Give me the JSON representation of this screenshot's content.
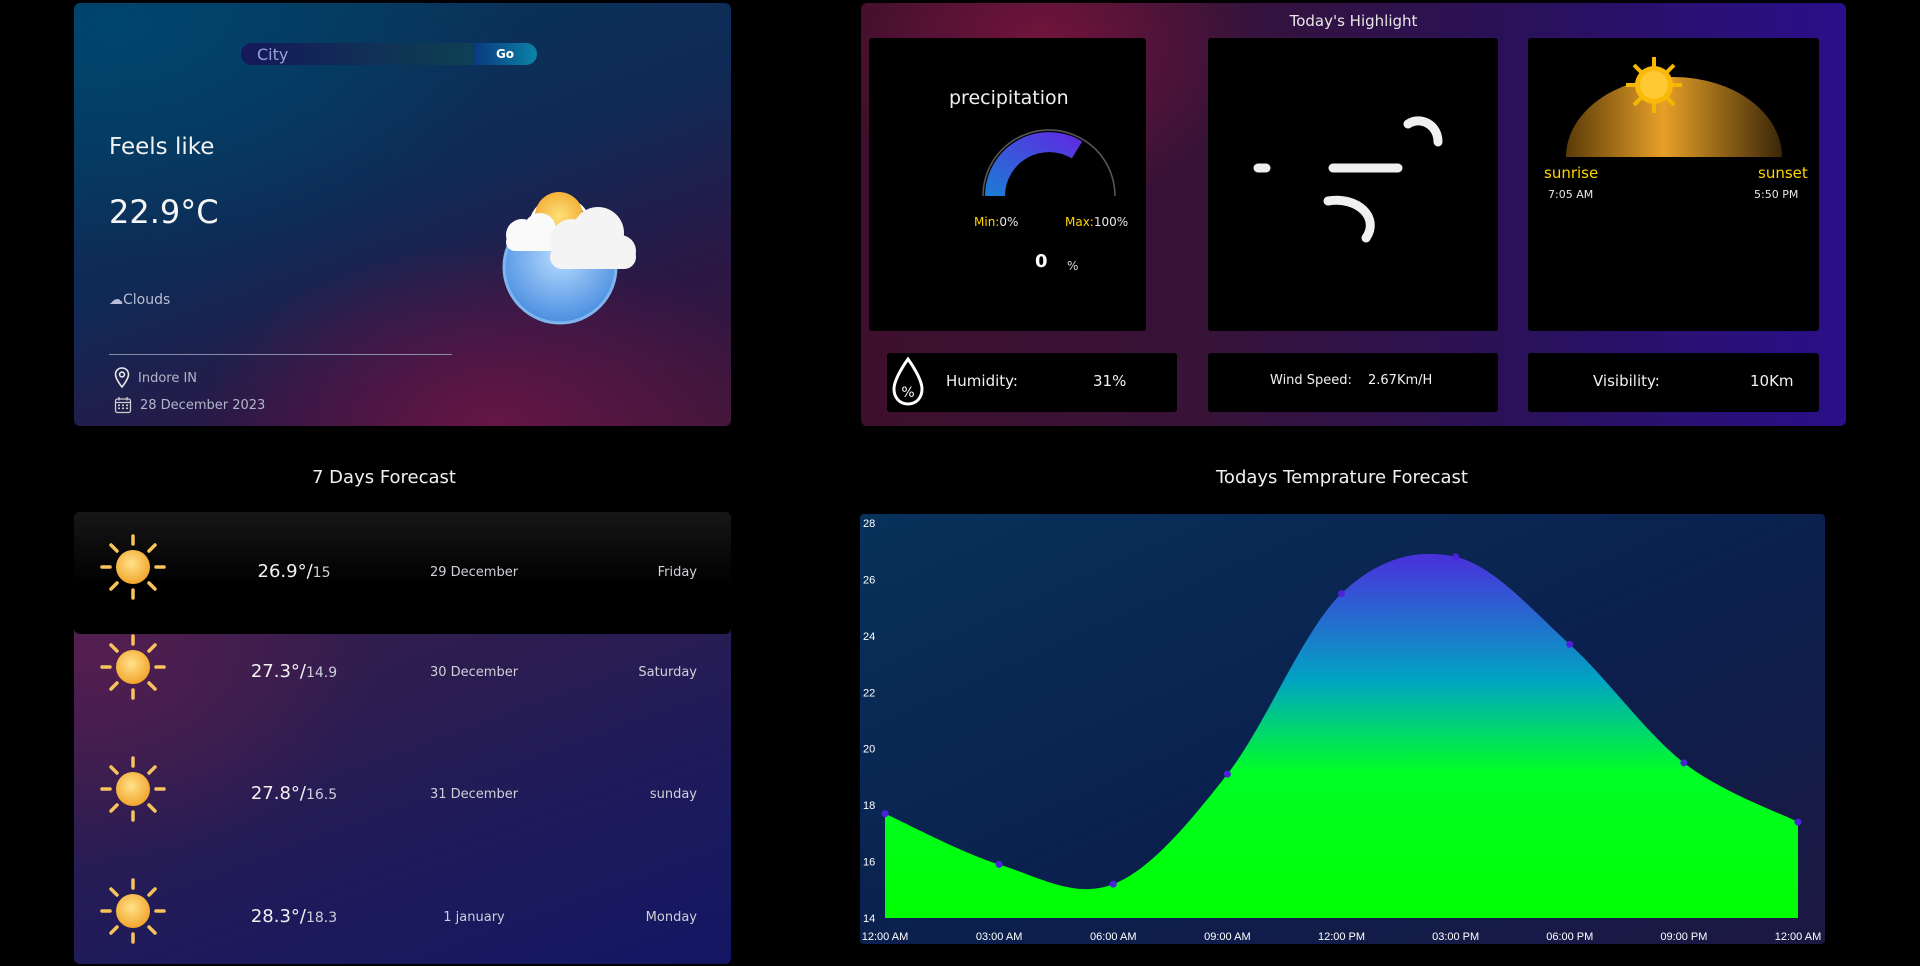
{
  "search": {
    "placeholder": "City",
    "go_label": "Go"
  },
  "current": {
    "feels_like_label": "Feels like",
    "temperature": "22.9°C",
    "condition": "☁Clouds",
    "location": "Indore IN",
    "date": "28 December 2023",
    "icon": "cloud-sun-icon"
  },
  "highlight": {
    "title": "Today's Highlight",
    "precipitation": {
      "label": "precipitation",
      "min_label": "Min:",
      "min_value": "0%",
      "max_label": "Max:",
      "max_value": "100%",
      "value": "0",
      "unit": "%"
    },
    "sun": {
      "sunrise_label": "sunrise",
      "sunrise_time": "7:05 AM",
      "sunset_label": "sunset",
      "sunset_time": "5:50 PM"
    },
    "humidity": {
      "label": "Humidity:",
      "value": "31%",
      "icon": "humidity-drop-icon"
    },
    "wind": {
      "label": "Wind Speed:",
      "value": "2.67Km/H",
      "icon": "wind-icon"
    },
    "visibility": {
      "label": "Visibility:",
      "value": "10Km"
    }
  },
  "forecast": {
    "title": "7 Days Forecast",
    "days": [
      {
        "temp": "26.9°/",
        "low": "15",
        "date": "29 December",
        "day": "Friday",
        "icon": "sun-icon"
      },
      {
        "temp": "27.3°/",
        "low": "14.9",
        "date": "30 December",
        "day": "Saturday",
        "icon": "sun-icon"
      },
      {
        "temp": "27.8°/",
        "low": "16.5",
        "date": "31 December",
        "day": "sunday",
        "icon": "sun-icon"
      },
      {
        "temp": "28.3°/",
        "low": "18.3",
        "date": "1 january",
        "day": "Monday",
        "icon": "sun-icon"
      }
    ]
  },
  "chart_title": "Todays Temprature Forecast",
  "colors": {
    "accent_yellow": "#ffd400",
    "point_color": "#4b22d8"
  },
  "chart_data": {
    "type": "area",
    "title": "Todays Temprature Forecast",
    "xlabel": "",
    "ylabel": "",
    "categories": [
      "12:00 AM",
      "03:00 AM",
      "06:00 AM",
      "09:00 AM",
      "12:00 PM",
      "03:00 PM",
      "06:00 PM",
      "09:00 PM",
      "12:00 AM"
    ],
    "values": [
      17.7,
      15.9,
      15.2,
      19.1,
      25.5,
      26.8,
      23.7,
      19.5,
      17.4
    ],
    "ylim": [
      14,
      28
    ],
    "yticks": [
      14,
      16,
      18,
      20,
      22,
      24,
      26,
      28
    ],
    "grid": false
  }
}
